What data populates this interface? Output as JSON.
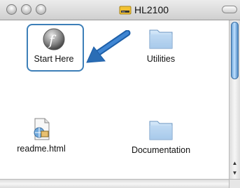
{
  "window": {
    "title": "HL2100",
    "title_icon": "brother-disk-icon"
  },
  "items": [
    {
      "label": "Start Here",
      "icon": "flash-installer-icon",
      "selected": true
    },
    {
      "label": "Utilities",
      "icon": "folder-icon",
      "selected": false
    },
    {
      "label": "readme.html",
      "icon": "html-document-icon",
      "selected": false
    },
    {
      "label": "Documentation",
      "icon": "folder-icon",
      "selected": false
    }
  ],
  "colors": {
    "selection": "#3d7fb8",
    "pointer_arrow": "#2a6db5",
    "folder": "#a9c9ea"
  }
}
